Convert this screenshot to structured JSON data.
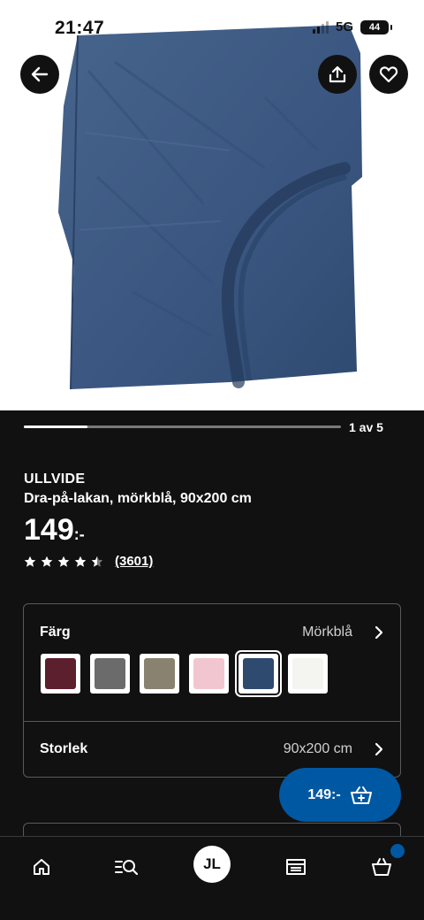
{
  "status_bar": {
    "time": "21:47",
    "network": "5G",
    "battery": "44"
  },
  "gallery": {
    "current": 1,
    "total": 5,
    "indicator_label": "1 av 5",
    "progress": 0.2
  },
  "product": {
    "brand": "ULLVIDE",
    "description": "Dra-på-lakan, mörkblå, 90x200 cm",
    "price": "149",
    "price_suffix": ":-",
    "rating": 4.5,
    "review_count": "(3601)"
  },
  "options": {
    "color": {
      "label": "Färg",
      "value": "Mörkblå",
      "swatches": [
        {
          "name": "burgundy",
          "color": "#5c1f2e"
        },
        {
          "name": "grey",
          "color": "#6b6b6b"
        },
        {
          "name": "beige-grey",
          "color": "#8a8270"
        },
        {
          "name": "pink",
          "color": "#f2c6d0"
        },
        {
          "name": "dark-blue",
          "color": "#2e4a6e"
        },
        {
          "name": "white",
          "color": "#f4f4f0"
        }
      ],
      "selected_index": 4
    },
    "size": {
      "label": "Storlek",
      "value": "90x200 cm"
    }
  },
  "cart_button": {
    "label": "149:-"
  },
  "nav": {
    "avatar_initials": "JL"
  },
  "colors": {
    "accent": "#0058a3",
    "background": "#111111",
    "product": "#3d5a80"
  }
}
